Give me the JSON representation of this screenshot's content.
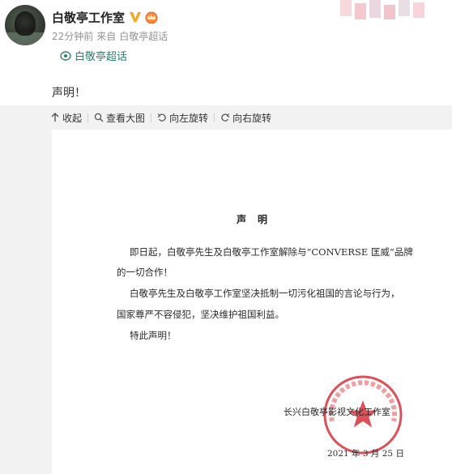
{
  "post": {
    "username": "白敬亭工作室",
    "verified_icon": "verified-v-icon",
    "vip_icon": "vip-crown-icon",
    "time": "22分钟前",
    "source_prefix": "来自",
    "source": "白敬亭超话",
    "topic": "白敬亭超话",
    "text": "声明！"
  },
  "toolbar": {
    "collapse": "收起",
    "view_large": "查看大图",
    "rotate_left": "向左旋转",
    "rotate_right": "向右旋转"
  },
  "document": {
    "title": "声明",
    "para1_line1": "即日起，白敬亭先生及白敬亭工作室解除与“CONVERSE 匡威”品牌",
    "para1_line2": "的一切合作！",
    "para2_line1": "白敬亭先生及白敬亭工作室坚决抵制一切污化祖国的言论与行为，",
    "para2_line2": "国家尊严不容侵犯，坚决维护祖国利益。",
    "para3": "特此声明！",
    "company": "长兴白敬亭影视文化工作室",
    "date": "2021 年 3 月 25 日",
    "seal_text": "长兴白敬亭影视文化工作室",
    "seal_color": "#d8323b"
  },
  "colors": {
    "topic": "#2f7f6f",
    "verified": "#f5a623",
    "toolbar_bg": "#f2f2f2"
  }
}
